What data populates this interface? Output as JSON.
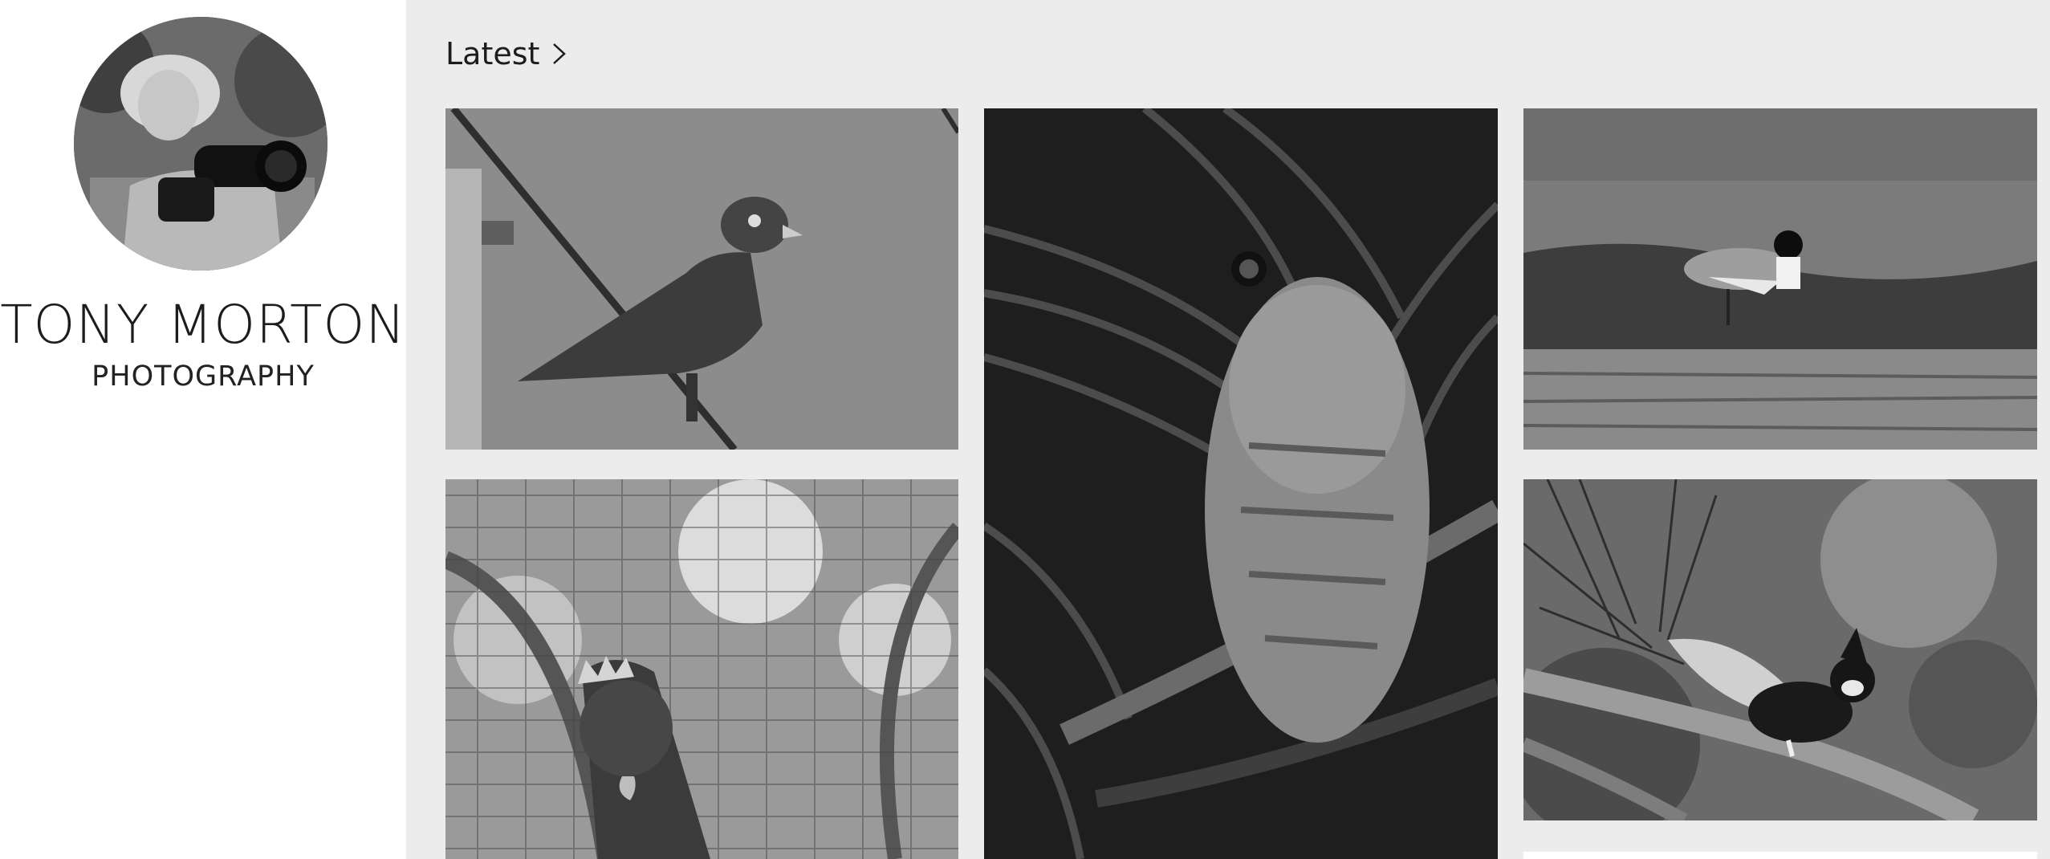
{
  "sidebar": {
    "avatar_icon": "photographer-avatar",
    "brand_name": "TONY MORTON",
    "brand_sub": "PHOTOGRAPHY"
  },
  "gallery": {
    "section_label": "Latest",
    "section_icon": "chevron-right-icon",
    "photos": [
      {
        "subject": "bird-on-wire-photo"
      },
      {
        "subject": "owl-in-palm-photo"
      },
      {
        "subject": "wader-in-wetland-photo"
      },
      {
        "subject": "cockatoo-behind-mesh-photo"
      },
      {
        "subject": "crested-bird-on-branch-photo"
      }
    ]
  }
}
